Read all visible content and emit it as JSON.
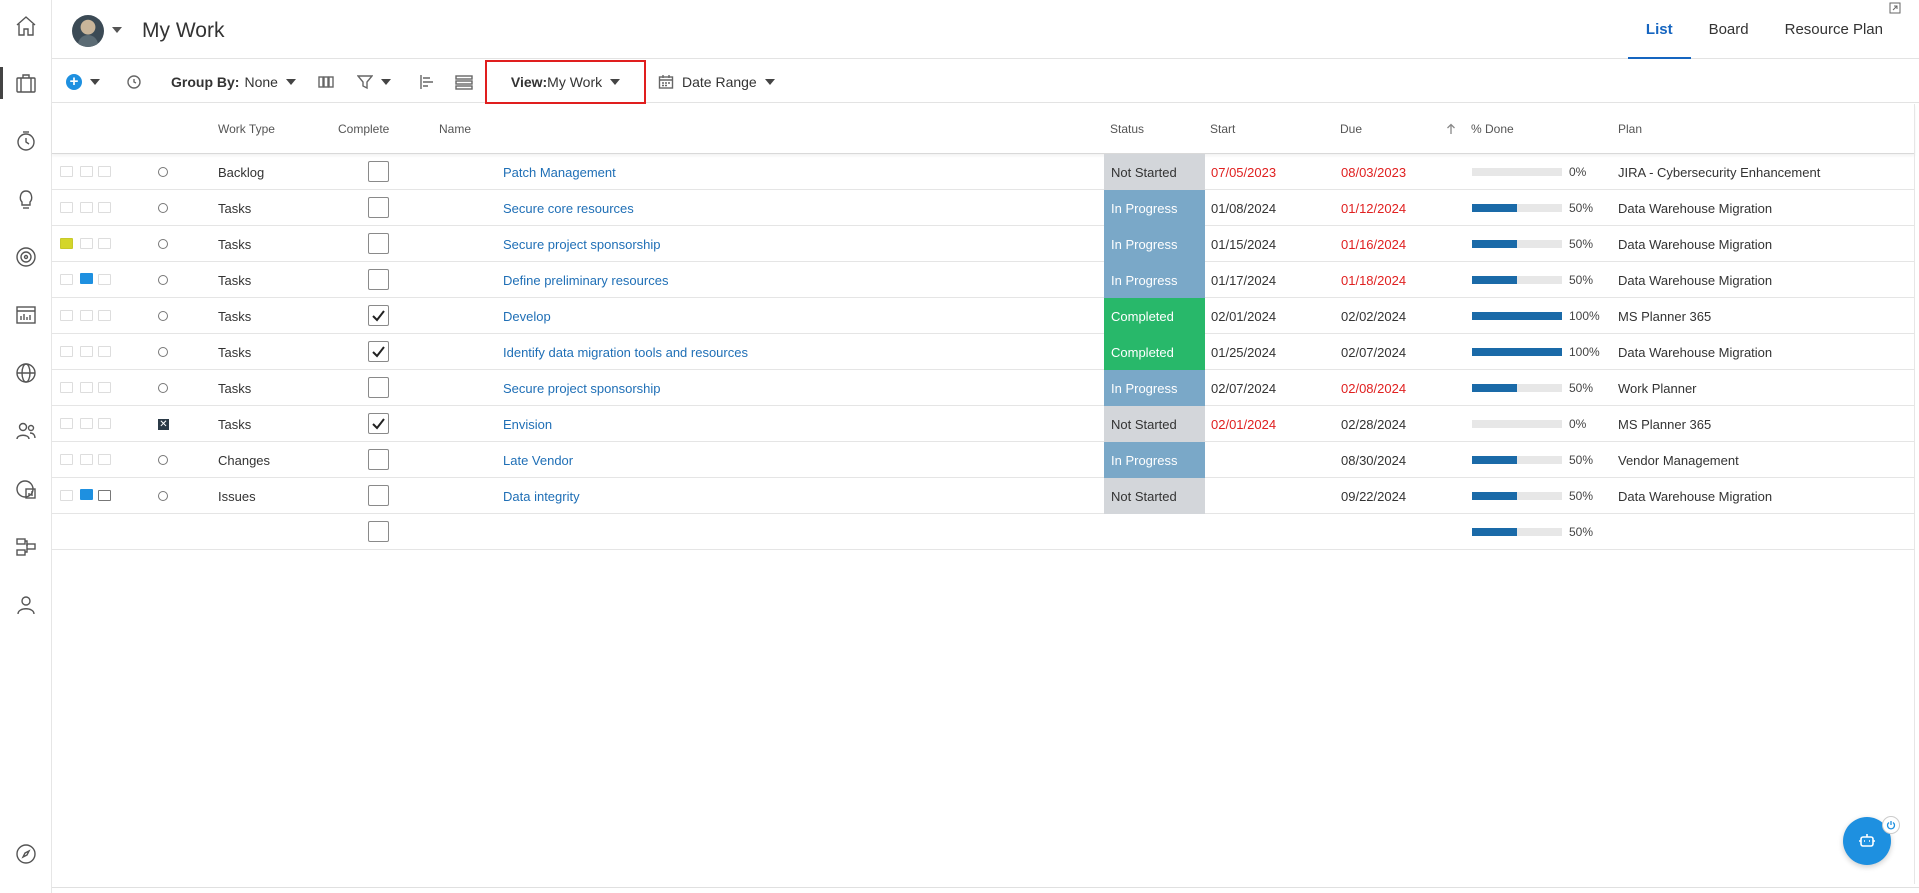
{
  "header": {
    "title": "My Work",
    "tabs": [
      {
        "label": "List",
        "active": true
      },
      {
        "label": "Board",
        "active": false
      },
      {
        "label": "Resource Plan",
        "active": false
      }
    ]
  },
  "toolbar": {
    "group_by_label": "Group By:",
    "group_by_value": "None",
    "view_label": "View:",
    "view_value": "My Work",
    "date_range_label": "Date Range"
  },
  "columns": {
    "work_type": "Work Type",
    "complete": "Complete",
    "name": "Name",
    "status": "Status",
    "start": "Start",
    "due": "Due",
    "pct_done": "% Done",
    "plan": "Plan"
  },
  "rows": [
    {
      "work_type": "Backlog",
      "complete": false,
      "name": "Patch Management",
      "status": "Not Started",
      "start": "07/05/2023",
      "start_late": true,
      "due": "08/03/2023",
      "due_late": true,
      "pct": 0,
      "pct_label": "0%",
      "plan": "JIRA - Cybersecurity Enhancement"
    },
    {
      "work_type": "Tasks",
      "complete": false,
      "name": "Secure core resources",
      "status": "In Progress",
      "start": "01/08/2024",
      "start_late": false,
      "due": "01/12/2024",
      "due_late": true,
      "pct": 50,
      "pct_label": "50%",
      "plan": "Data Warehouse Migration"
    },
    {
      "work_type": "Tasks",
      "complete": false,
      "name": "Secure project sponsorship",
      "status": "In Progress",
      "start": "01/15/2024",
      "start_late": false,
      "due": "01/16/2024",
      "due_late": true,
      "pct": 50,
      "pct_label": "50%",
      "plan": "Data Warehouse Migration"
    },
    {
      "work_type": "Tasks",
      "complete": false,
      "name": "Define preliminary resources",
      "status": "In Progress",
      "start": "01/17/2024",
      "start_late": false,
      "due": "01/18/2024",
      "due_late": true,
      "pct": 50,
      "pct_label": "50%",
      "plan": "Data Warehouse Migration"
    },
    {
      "work_type": "Tasks",
      "complete": true,
      "name": "Develop",
      "status": "Completed",
      "start": "02/01/2024",
      "start_late": false,
      "due": "02/02/2024",
      "due_late": false,
      "pct": 100,
      "pct_label": "100%",
      "plan": "MS Planner 365"
    },
    {
      "work_type": "Tasks",
      "complete": true,
      "name": "Identify data migration tools and resources",
      "status": "Completed",
      "start": "01/25/2024",
      "start_late": false,
      "due": "02/07/2024",
      "due_late": false,
      "pct": 100,
      "pct_label": "100%",
      "plan": "Data Warehouse Migration"
    },
    {
      "work_type": "Tasks",
      "complete": false,
      "name": "Secure project sponsorship",
      "status": "In Progress",
      "start": "02/07/2024",
      "start_late": false,
      "due": "02/08/2024",
      "due_late": true,
      "pct": 50,
      "pct_label": "50%",
      "plan": "Work Planner"
    },
    {
      "work_type": "Tasks",
      "complete": true,
      "name": "Envision",
      "status": "Not Started",
      "start": "02/01/2024",
      "start_late": true,
      "due": "02/28/2024",
      "due_late": false,
      "pct": 0,
      "pct_label": "0%",
      "plan": "MS Planner 365"
    },
    {
      "work_type": "Changes",
      "complete": false,
      "name": "Late Vendor",
      "status": "In Progress",
      "start": "",
      "start_late": false,
      "due": "08/30/2024",
      "due_late": false,
      "pct": 50,
      "pct_label": "50%",
      "plan": "Vendor Management"
    },
    {
      "work_type": "Issues",
      "complete": false,
      "name": "Data integrity",
      "status": "Not Started",
      "start": "",
      "start_late": false,
      "due": "09/22/2024",
      "due_late": false,
      "pct": 50,
      "pct_label": "50%",
      "plan": "Data Warehouse Migration"
    }
  ],
  "summary": {
    "pct": 50,
    "pct_label": "50%"
  },
  "colors": {
    "accent": "#1565c0",
    "not_started": "#d3d6da",
    "in_progress": "#7aa8c8",
    "completed": "#28b86a",
    "late": "#e02020",
    "progress_fill": "#1a6aa8",
    "highlight": "#e01e1e"
  }
}
